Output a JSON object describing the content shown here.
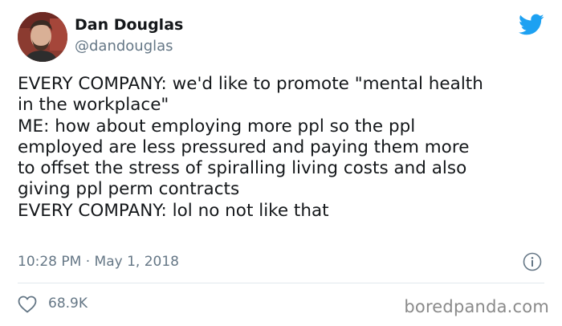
{
  "author": {
    "display_name": "Dan Douglas",
    "handle": "@dandouglas"
  },
  "tweet": {
    "lines": [
      "EVERY COMPANY: we'd like to promote \"mental health",
      "in the workplace\"",
      "ME: how about employing more ppl so the ppl",
      "employed are less pressured and paying them more",
      "to offset the stress of spiralling living costs and also",
      "giving ppl perm contracts",
      "EVERY COMPANY: lol no not like that"
    ],
    "timestamp": "10:28 PM · May 1, 2018"
  },
  "engagement": {
    "likes": "68.9K"
  },
  "watermark": "boredpanda.com",
  "icons": {
    "brand": "twitter-bird-icon",
    "info": "info-icon",
    "like": "heart-icon"
  },
  "colors": {
    "twitter_blue": "#1da1f2",
    "text": "#14171a",
    "secondary_text": "#657786",
    "divider": "#e1e8ed"
  }
}
